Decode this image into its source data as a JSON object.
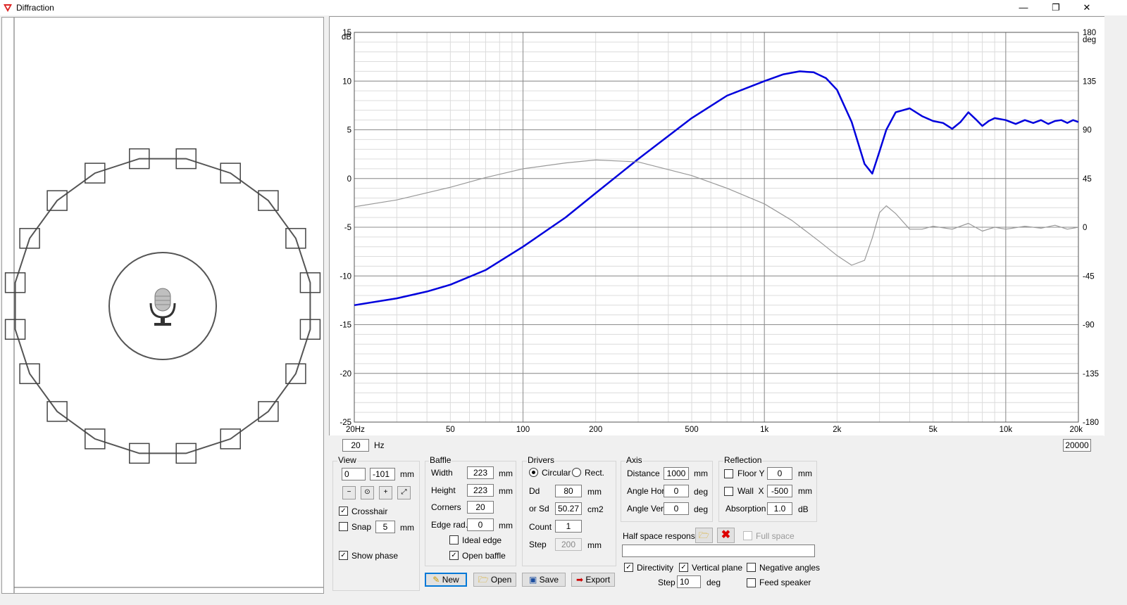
{
  "window": {
    "title": "Diffraction",
    "minimize": "—",
    "restore": "❐",
    "close": "✕"
  },
  "chart_data": {
    "type": "line",
    "x_scale": "log",
    "xlim": [
      20,
      20000
    ],
    "ylim": [
      -25,
      15
    ],
    "ylim_right": [
      -180,
      180
    ],
    "ylabel": "dB",
    "ylabel_right": "deg",
    "x_ticks": [
      {
        "v": 20,
        "l": "20Hz"
      },
      {
        "v": 50,
        "l": "50"
      },
      {
        "v": 100,
        "l": "100"
      },
      {
        "v": 200,
        "l": "200"
      },
      {
        "v": 500,
        "l": "500"
      },
      {
        "v": 1000,
        "l": "1k"
      },
      {
        "v": 2000,
        "l": "2k"
      },
      {
        "v": 5000,
        "l": "5k"
      },
      {
        "v": 10000,
        "l": "10k"
      },
      {
        "v": 20000,
        "l": "20k"
      }
    ],
    "y_ticks": [
      15,
      10,
      5,
      0,
      -5,
      -10,
      -15,
      -20,
      -25
    ],
    "y_ticks_right": [
      180,
      135,
      90,
      45,
      0,
      -45,
      -90,
      -135,
      -180
    ],
    "grid": true,
    "series": [
      {
        "color": "#0000dd",
        "x": [
          20,
          30,
          40,
          50,
          70,
          100,
          150,
          200,
          300,
          500,
          700,
          1000,
          1200,
          1400,
          1600,
          1800,
          2000,
          2300,
          2600,
          2800,
          3000,
          3200,
          3500,
          4000,
          4500,
          5000,
          5500,
          6000,
          6500,
          7000,
          7500,
          8000,
          8500,
          9000,
          10000,
          11000,
          12000,
          13000,
          14000,
          15000,
          16000,
          17000,
          18000,
          19000,
          20000
        ],
        "y": [
          -13,
          -12.3,
          -11.6,
          -10.9,
          -9.4,
          -7,
          -4,
          -1.5,
          2,
          6.2,
          8.5,
          10,
          10.7,
          11,
          10.9,
          10.3,
          9.1,
          5.8,
          1.5,
          0.5,
          2.8,
          5,
          6.8,
          7.2,
          6.4,
          5.9,
          5.7,
          5.1,
          5.8,
          6.8,
          6.1,
          5.4,
          5.9,
          6.2,
          6,
          5.6,
          6,
          5.7,
          6,
          5.6,
          5.9,
          6,
          5.7,
          6,
          5.8
        ]
      },
      {
        "color": "#999999",
        "x": [
          20,
          30,
          50,
          70,
          100,
          150,
          200,
          300,
          500,
          700,
          1000,
          1300,
          1700,
          2000,
          2300,
          2600,
          2800,
          3000,
          3200,
          3500,
          4000,
          4500,
          5000,
          6000,
          7000,
          8000,
          9000,
          10000,
          12000,
          14000,
          16000,
          18000,
          20000
        ],
        "y": [
          -2.9,
          -2.2,
          -0.9,
          0.1,
          1,
          1.6,
          1.9,
          1.7,
          0.3,
          -1,
          -2.6,
          -4.3,
          -6.5,
          -7.9,
          -8.9,
          -8.4,
          -6.1,
          -3.5,
          -2.8,
          -3.6,
          -5.2,
          -5.2,
          -4.9,
          -5.2,
          -4.6,
          -5.4,
          -5,
          -5.2,
          -4.9,
          -5.1,
          -4.8,
          -5.2,
          -5
        ]
      }
    ]
  },
  "freq_min": "20",
  "freq_unit": "Hz",
  "freq_max": "20000",
  "view": {
    "label": "View",
    "x": "0",
    "y": "-101",
    "unit": "mm",
    "crosshair": "Crosshair",
    "crosshair_checked": "✓",
    "snap": "Snap",
    "snap_value": "5",
    "snap_unit": "mm",
    "show_phase": "Show phase",
    "show_phase_checked": "✓"
  },
  "baffle": {
    "label": "Baffle",
    "width_label": "Width",
    "width": "223",
    "width_unit": "mm",
    "height_label": "Height",
    "height": "223",
    "height_unit": "mm",
    "corners_label": "Corners",
    "corners": "20",
    "edge_label": "Edge rad.",
    "edge": "0",
    "edge_unit": "mm",
    "ideal_edge": "Ideal edge",
    "open_baffle": "Open baffle",
    "open_baffle_checked": "✓"
  },
  "drivers": {
    "label": "Drivers",
    "circular": "Circular",
    "rect": "Rect.",
    "dd_label": "Dd",
    "dd": "80",
    "dd_unit": "mm",
    "sd_label": "or Sd",
    "sd": "50.27",
    "sd_unit": "cm2",
    "count_label": "Count",
    "count": "1",
    "step_label": "Step",
    "step": "200",
    "step_unit": "mm"
  },
  "axis": {
    "label": "Axis",
    "distance_label": "Distance",
    "distance": "1000",
    "distance_unit": "mm",
    "angle_hor_label": "Angle Hor",
    "angle_hor": "0",
    "angle_hor_unit": "deg",
    "angle_ver_label": "Angle Ver",
    "angle_ver": "0",
    "angle_ver_unit": "deg"
  },
  "reflection": {
    "label": "Reflection",
    "floor_label": "Floor Y",
    "floor": "0",
    "floor_unit": "mm",
    "wall_label": "Wall  X",
    "wall": "-500",
    "wall_unit": "mm",
    "absorption_label": "Absorption",
    "absorption": "1.0",
    "absorption_unit": "dB"
  },
  "half_space": {
    "label": "Half space response",
    "full_space": "Full space",
    "path": ""
  },
  "options": {
    "directivity": "Directivity",
    "directivity_checked": "✓",
    "vertical_plane": "Vertical plane",
    "vertical_plane_checked": "✓",
    "negative_angles": "Negative angles",
    "step_label": "Step",
    "step": "10",
    "step_unit": "deg",
    "feed_speaker": "Feed speaker"
  },
  "buttons": {
    "new": "New",
    "open": "Open",
    "save": "Save",
    "export": "Export"
  },
  "icons": {
    "zoom_out": "zoom-out-icon",
    "zoom_fit": "zoom-fit-icon",
    "zoom_in": "zoom-in-icon",
    "expand": "expand-icon",
    "microphone": "microphone-icon",
    "folder": "folder-icon",
    "delete": "delete-icon"
  }
}
